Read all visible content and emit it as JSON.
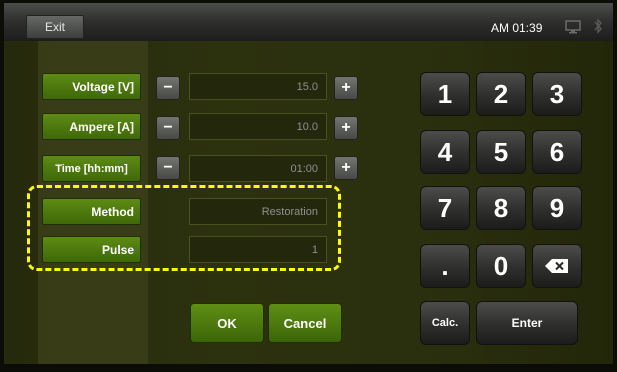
{
  "topbar": {
    "exit_label": "Exit",
    "time": "AM 01:39"
  },
  "settings": {
    "voltage": {
      "label": "Voltage [V]",
      "value": "15.0"
    },
    "ampere": {
      "label": "Ampere [A]",
      "value": "10.0"
    },
    "time": {
      "label": "Time [hh:mm]",
      "value": "01:00"
    },
    "method": {
      "label": "Method",
      "value": "Restoration"
    },
    "pulse": {
      "label": "Pulse",
      "value": "1"
    },
    "minus": "−",
    "plus": "+"
  },
  "actions": {
    "ok": "OK",
    "cancel": "Cancel"
  },
  "keypad": {
    "keys": [
      "1",
      "2",
      "3",
      "4",
      "5",
      "6",
      "7",
      "8",
      "9",
      ".",
      "0"
    ],
    "calc": "Calc.",
    "enter": "Enter"
  },
  "colors": {
    "accent": "#4f7a10",
    "highlight": "#ffff00"
  }
}
